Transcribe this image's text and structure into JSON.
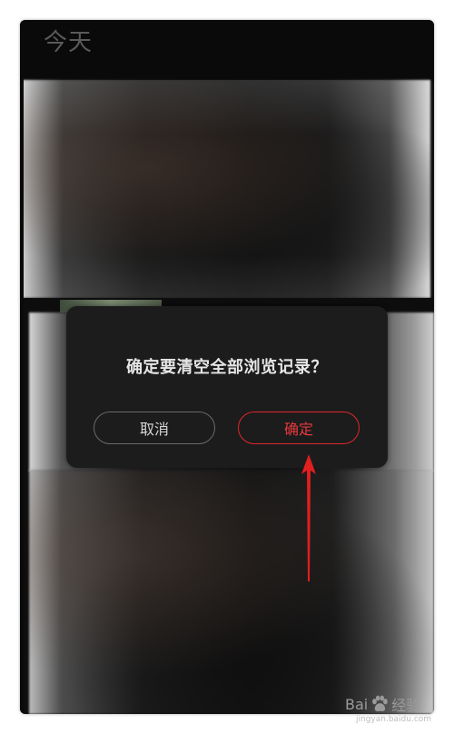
{
  "header": {
    "title": "今天"
  },
  "dialog": {
    "message": "确定要清空全部浏览记录？",
    "cancel_label": "取消",
    "confirm_label": "确定"
  },
  "colors": {
    "accent": "#e0262d",
    "dialog_bg": "#1c1c1c",
    "annotation_arrow": "#e01f1f"
  },
  "watermark": {
    "brand_left": "Bai",
    "brand_right": "经验",
    "icon": "paw-icon",
    "sub": "jingyan.baidu.com"
  }
}
